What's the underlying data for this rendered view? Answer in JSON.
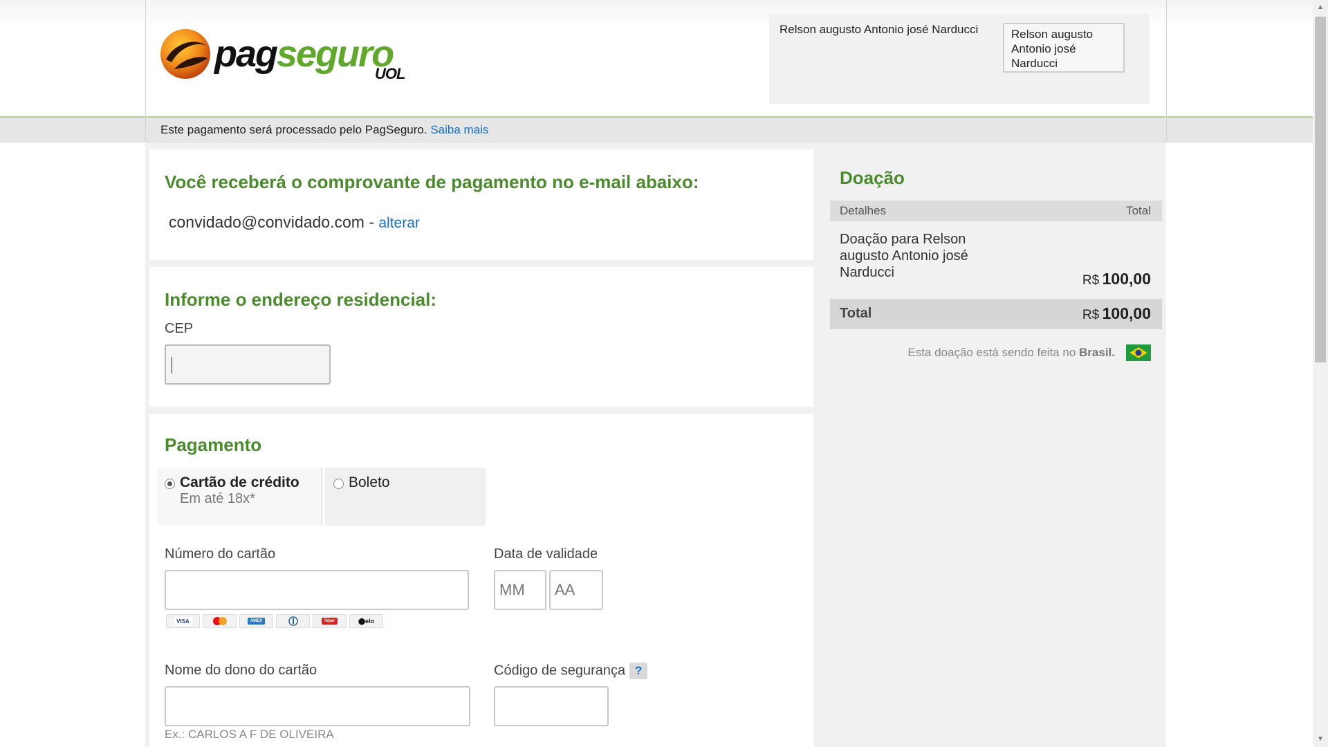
{
  "header": {
    "logo_text_1": "pag",
    "logo_text_2": "seguro",
    "logo_sub": "UOL",
    "user_name": "Relson augusto Antonio josé Narducci",
    "user_select_value": "Relson augusto Antonio josé Narducci"
  },
  "infobar": {
    "text": "Este pagamento será processado pelo PagSeguro.",
    "link": "Saiba mais"
  },
  "email_section": {
    "title": "Você receberá o comprovante de pagamento no e-mail abaixo:",
    "email": "convidado@convidado.com",
    "separator": "-",
    "change_link": "alterar"
  },
  "address_section": {
    "title": "Informe o endereço residencial:",
    "cep_label": "CEP",
    "cep_value": ""
  },
  "payment_section": {
    "title": "Pagamento",
    "tabs": [
      {
        "label": "Cartão de crédito",
        "sub": "Em até 18x*",
        "selected": true
      },
      {
        "label": "Boleto",
        "selected": false
      }
    ],
    "card_number_label": "Número do cartão",
    "card_number_value": "",
    "expiry_label": "Data de validade",
    "expiry_month_placeholder": "MM",
    "expiry_year_placeholder": "AA",
    "brands": [
      "VISA",
      "mastercard",
      "AMEX",
      "Diners",
      "Hipercard",
      "elo"
    ],
    "holder_label": "Nome do dono do cartão",
    "holder_value": "",
    "holder_hint": "Ex.: CARLOS A F DE OLIVEIRA",
    "cvv_label": "Código de segurança",
    "cvv_help": "?",
    "cvv_value": ""
  },
  "summary": {
    "title": "Doação",
    "col_details": "Detalhes",
    "col_total": "Total",
    "item_description": "Doação para Relson augusto Antonio josé Narducci",
    "item_currency": "R$",
    "item_price": "100,00",
    "total_label": "Total",
    "total_currency": "R$",
    "total_price": "100,00",
    "country_text": "Esta doação está sendo feita no",
    "country_name": "Brasil."
  },
  "colors": {
    "brand_green": "#4a8b2c",
    "link_blue": "#1a6fc4"
  }
}
